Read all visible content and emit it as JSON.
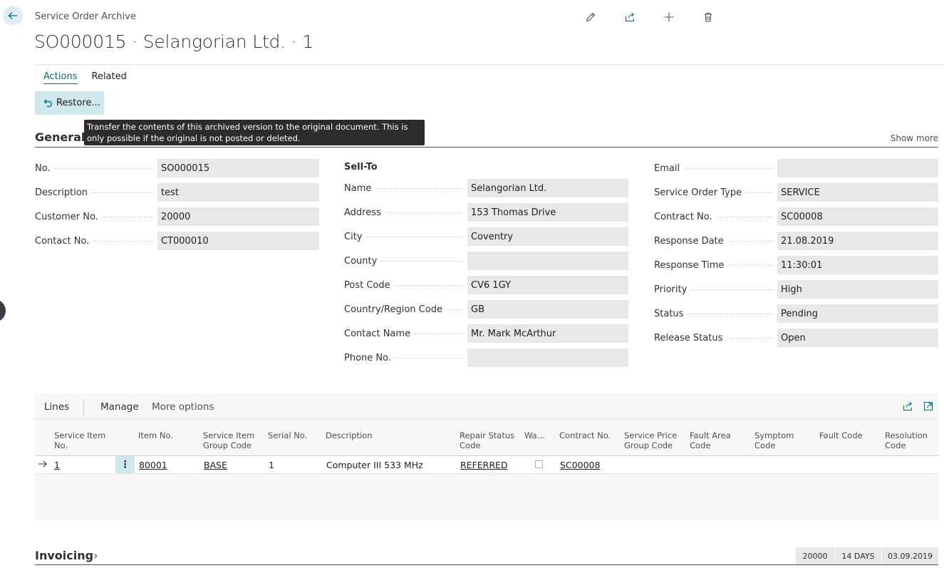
{
  "header": {
    "breadcrumb": "Service Order Archive",
    "title": "SO000015 · Selangorian Ltd. · 1"
  },
  "icons": {
    "back": "arrow-left-icon",
    "edit": "pencil-icon",
    "share": "share-icon",
    "new": "plus-icon",
    "delete": "trash-icon"
  },
  "tabs": [
    {
      "label": "Actions",
      "active": true
    },
    {
      "label": "Related",
      "active": false
    }
  ],
  "restore_button": {
    "label": "Restore..."
  },
  "tooltip": {
    "text": "Transfer the contents of this archived version to the original document. This is only possible if the original is not posted or deleted."
  },
  "general": {
    "title": "General",
    "show_more": "Show more",
    "col1": [
      {
        "label": "No.",
        "value": "SO000015"
      },
      {
        "label": "Description",
        "value": "test"
      },
      {
        "label": "Customer No.",
        "value": "20000"
      },
      {
        "label": "Contact No.",
        "value": "CT000010"
      }
    ],
    "sell_to_heading": "Sell-To",
    "col2": [
      {
        "label": "Name",
        "value": "Selangorian Ltd."
      },
      {
        "label": "Address",
        "value": "153 Thomas Drive"
      },
      {
        "label": "City",
        "value": "Coventry"
      },
      {
        "label": "County",
        "value": ""
      },
      {
        "label": "Post Code",
        "value": "CV6 1GY"
      },
      {
        "label": "Country/Region Code",
        "value": "GB"
      },
      {
        "label": "Contact Name",
        "value": "Mr. Mark McArthur"
      },
      {
        "label": "Phone No.",
        "value": ""
      }
    ],
    "col3": [
      {
        "label": "Email",
        "value": ""
      },
      {
        "label": "Service Order Type",
        "value": "SERVICE"
      },
      {
        "label": "Contract No.",
        "value": "SC00008"
      },
      {
        "label": "Response Date",
        "value": "21.08.2019"
      },
      {
        "label": "Response Time",
        "value": "11:30:01"
      },
      {
        "label": "Priority",
        "value": "High"
      },
      {
        "label": "Status",
        "value": "Pending"
      },
      {
        "label": "Release Status",
        "value": "Open"
      }
    ]
  },
  "lines": {
    "title": "Lines",
    "manage": "Manage",
    "more_options": "More options",
    "columns": [
      {
        "l1": "Service Item",
        "l2": "No."
      },
      {
        "l1": "",
        "l2": "Item No."
      },
      {
        "l1": "Service Item",
        "l2": "Group Code"
      },
      {
        "l1": "",
        "l2": "Serial No."
      },
      {
        "l1": "",
        "l2": "Description"
      },
      {
        "l1": "Repair Status",
        "l2": "Code"
      },
      {
        "l1": "",
        "l2": "Wa..."
      },
      {
        "l1": "",
        "l2": "Contract No."
      },
      {
        "l1": "Service Price",
        "l2": "Group Code"
      },
      {
        "l1": "Fault Area",
        "l2": "Code"
      },
      {
        "l1": "Symptom",
        "l2": "Code"
      },
      {
        "l1": "",
        "l2": "Fault Code"
      },
      {
        "l1": "Resolution",
        "l2": "Code"
      }
    ],
    "rows": [
      {
        "service_item_no": "1",
        "item_no": "80001",
        "group_code": "BASE",
        "serial_no": "1",
        "description": "Computer III 533 MHz",
        "repair_status": "REFERRED",
        "warranty": false,
        "contract_no": "SC00008"
      }
    ]
  },
  "invoicing": {
    "title": "Invoicing",
    "summary": [
      "20000",
      "14 DAYS",
      "03.09.2019"
    ]
  }
}
